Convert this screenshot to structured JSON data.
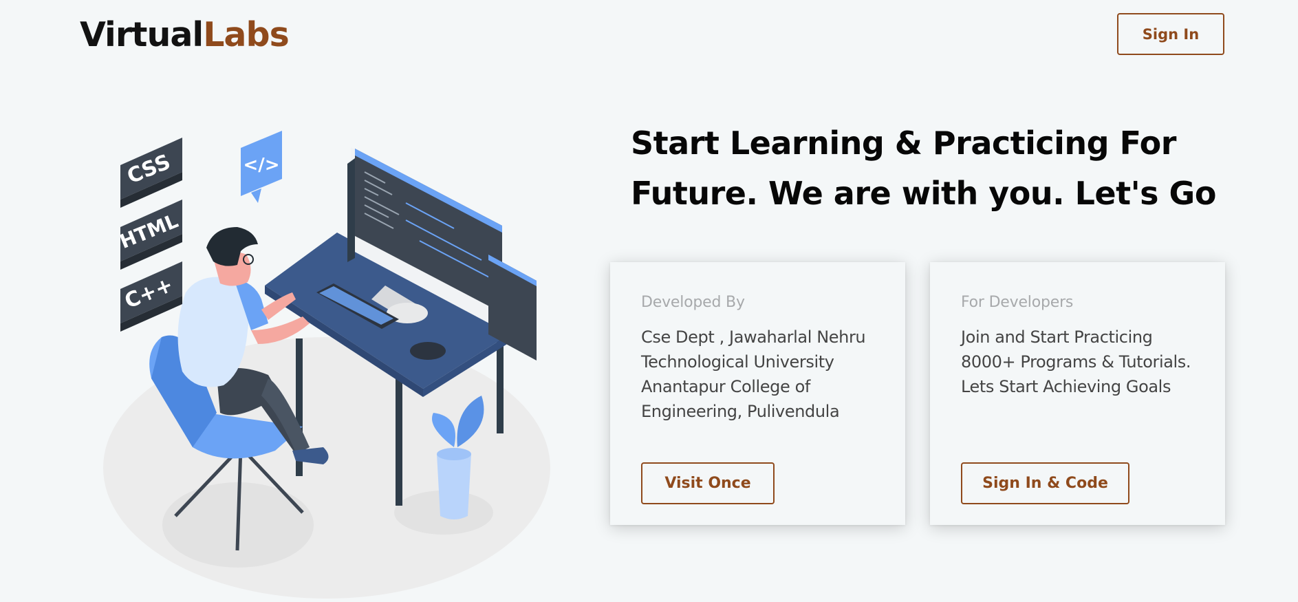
{
  "header": {
    "logo_part1": "Virtual",
    "logo_part2": "Labs",
    "signin_label": "Sign In"
  },
  "hero": {
    "title_line1": "Start Learning & Practicing For",
    "title_line2": "Future. We are with you. Let's Go"
  },
  "illustration": {
    "badges": [
      "CSS",
      "HTML",
      "C++"
    ],
    "code_bubble": "</>"
  },
  "cards": [
    {
      "caption": "Developed By",
      "body": "Cse Dept , Jawaharlal Nehru Technological University Anantapur College of Engineering, Pulivendula",
      "button": "Visit Once"
    },
    {
      "caption": "For Developers",
      "body": "Join and Start Practicing 8000+ Programs & Tutorials. Lets Start Achieving Goals",
      "button": "Sign In & Code"
    }
  ],
  "colors": {
    "background": "#f4f7f8",
    "accent_brown": "#8f4a1c",
    "illustration_blue": "#6ba3f5",
    "desk_navy": "#3c5a8c"
  }
}
